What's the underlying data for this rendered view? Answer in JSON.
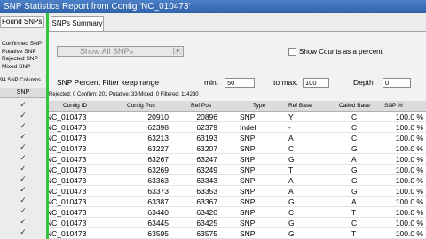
{
  "window": {
    "title": "SNP Statistics Report from Contig 'NC_010473'"
  },
  "left_panel": {
    "found_tab": "Found SNPs",
    "legend": [
      "Confirmed SNP",
      "Putative SNP",
      "Rejected SNP",
      "Mixed SNP"
    ],
    "summary": "94 SNP Columns",
    "column_header": "SNP",
    "check_glyph": "✓"
  },
  "tabs": [
    "SNPs Summary"
  ],
  "filter": {
    "show_select": "Show All SNPs",
    "show_counts_label": "Show Counts as a percent",
    "percent_filter_label": "SNP Percent Filter  keep range",
    "min_label": "min.",
    "min_value": "50",
    "max_label": "to max.",
    "max_value": "100",
    "depth_label": "Depth",
    "depth_value": "0"
  },
  "summary_line": "Rejected: 0 Confirm: 201 Putative: 33 Mixed: 0 Filtered: 114230",
  "columns": [
    "Contig ID",
    "Contig Pos",
    "Ref Pos",
    "Type",
    "Ref Base",
    "Called Base",
    "SNP %"
  ],
  "rows": [
    [
      "NC_010473",
      "20910",
      "20896",
      "SNP",
      "Y",
      "C",
      "100.0 %"
    ],
    [
      "NC_010473",
      "62398",
      "62379",
      "Indel",
      "-",
      "C",
      "100.0 %"
    ],
    [
      "NC_010473",
      "63213",
      "63193",
      "SNP",
      "A",
      "C",
      "100.0 %"
    ],
    [
      "NC_010473",
      "63227",
      "63207",
      "SNP",
      "C",
      "G",
      "100.0 %"
    ],
    [
      "NC_010473",
      "63267",
      "63247",
      "SNP",
      "G",
      "A",
      "100.0 %"
    ],
    [
      "NC_010473",
      "63269",
      "63249",
      "SNP",
      "T",
      "G",
      "100.0 %"
    ],
    [
      "NC_010473",
      "63363",
      "63343",
      "SNP",
      "A",
      "G",
      "100.0 %"
    ],
    [
      "NC_010473",
      "63373",
      "63353",
      "SNP",
      "A",
      "G",
      "100.0 %"
    ],
    [
      "NC_010473",
      "63387",
      "63367",
      "SNP",
      "G",
      "A",
      "100.0 %"
    ],
    [
      "NC_010473",
      "63440",
      "63420",
      "SNP",
      "C",
      "T",
      "100.0 %"
    ],
    [
      "NC_010473",
      "63445",
      "63425",
      "SNP",
      "G",
      "C",
      "100.0 %"
    ],
    [
      "NC_010473",
      "63595",
      "63575",
      "SNP",
      "G",
      "T",
      "100.0 %"
    ],
    [
      "NC_010473",
      "63694",
      "63674",
      "SNP",
      "C",
      "A",
      "100.0 %"
    ]
  ],
  "colors": {
    "divider": "#35c43d",
    "titlebar": "#3a6fb5"
  }
}
